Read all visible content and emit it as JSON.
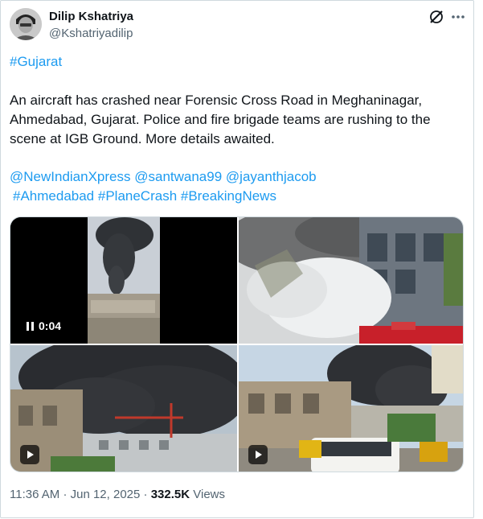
{
  "author": {
    "name": "Dilip Kshatriya",
    "handle": "@Kshatriyadilip"
  },
  "icons": [
    "grok-icon",
    "more-options-icon",
    "pause-icon",
    "play-icon"
  ],
  "tweet": {
    "hashtag_top": "#Gujarat",
    "body_lines": [
      "An aircraft has crashed near Forensic Cross Road in Meghaninagar,",
      "Ahmedabad, Gujarat. Police and fire brigade teams are rushing to the",
      "scene at IGB Ground. More details awaited."
    ],
    "mentions": [
      "@NewIndianXpress",
      "@santwana99",
      "@jayanthjacob"
    ],
    "hashtags": [
      "#Ahmedabad",
      "#PlaneCrash",
      "#BreakingNews"
    ]
  },
  "media": {
    "video_time": "0:04"
  },
  "meta": {
    "time": "11:36 AM",
    "separator": "·",
    "date": "Jun 12, 2025",
    "views_count": "332.5K",
    "views_label": "Views"
  },
  "colors": {
    "link": "#1d9bf0",
    "text": "#0f1419",
    "secondary": "#536471",
    "border": "#cfd9de"
  }
}
